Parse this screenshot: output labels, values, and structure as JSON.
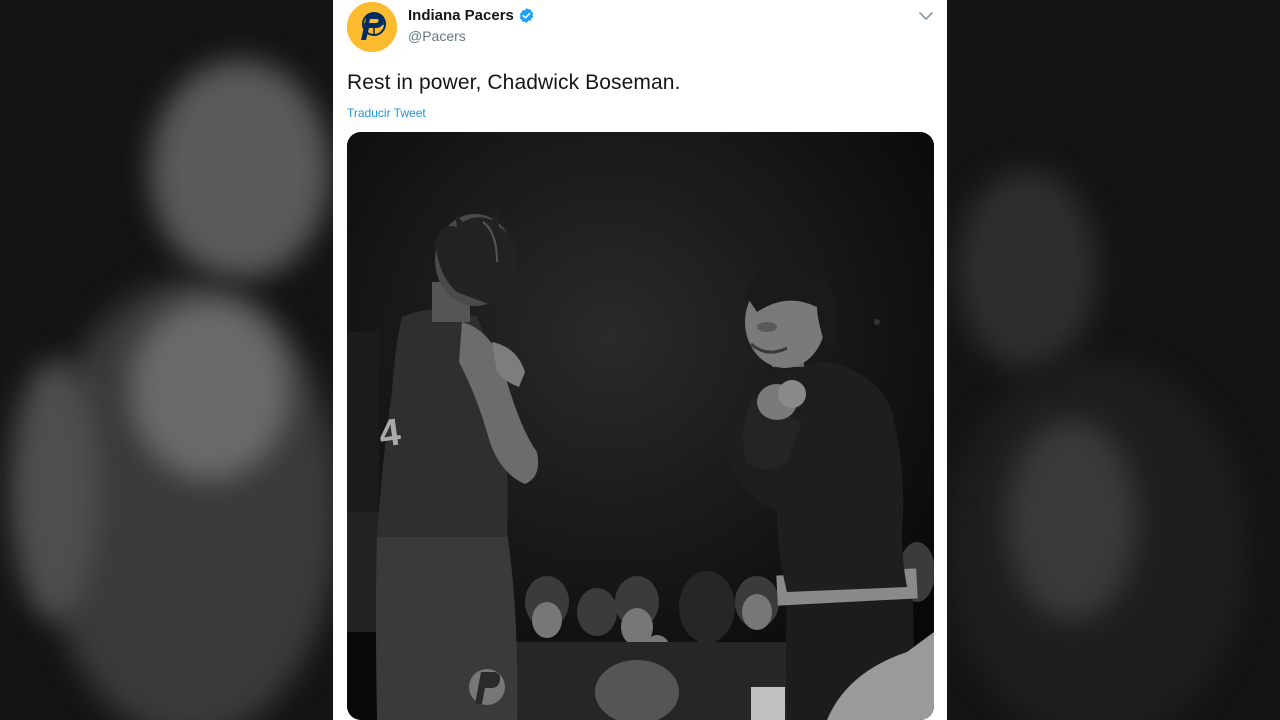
{
  "tweet": {
    "display_name": "Indiana Pacers",
    "handle": "@Pacers",
    "verified": true,
    "text": "Rest in power, Chadwick Boseman.",
    "translate_label": "Traducir Tweet",
    "avatar_icon": "pacers-logo-icon",
    "more_icon": "chevron-down-icon"
  },
  "media": {
    "kind": "black-and-white photo",
    "jersey_number": "4"
  },
  "colors": {
    "brand_gold": "#fdbb30",
    "brand_navy": "#002d62",
    "link_blue": "#1b95e0",
    "verified_blue": "#1da1f2",
    "text_primary": "#14171a",
    "text_secondary": "#657786"
  }
}
